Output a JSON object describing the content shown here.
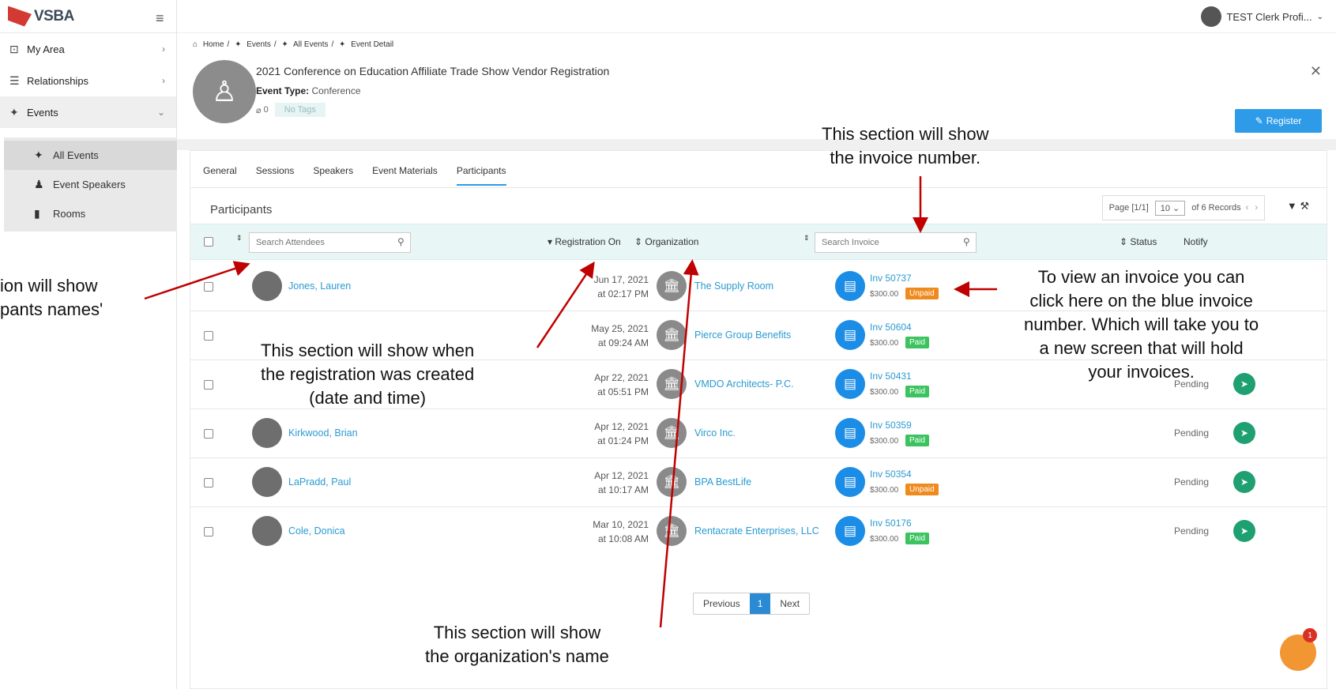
{
  "logo": {
    "text": "VSBA"
  },
  "user": {
    "name": "TEST Clerk Profi...",
    "chevron": "⌄"
  },
  "sidebar": {
    "items": [
      {
        "label": "My Area",
        "icon": "⊡"
      },
      {
        "label": "Relationships",
        "icon": "☰"
      },
      {
        "label": "Events",
        "icon": "✦"
      }
    ],
    "sub_items": [
      {
        "label": "All Events"
      },
      {
        "label": "Event Speakers"
      },
      {
        "label": "Rooms"
      }
    ]
  },
  "breadcrumb": [
    "Home",
    "Events",
    "All Events",
    "Event Detail"
  ],
  "event": {
    "title": "2021 Conference on Education Affiliate Trade Show Vendor Registration",
    "type_label": "Event Type:",
    "type_value": "Conference",
    "tag_count": "0",
    "no_tags": "No Tags",
    "register": "Register"
  },
  "tabs": [
    "General",
    "Sessions",
    "Speakers",
    "Event Materials",
    "Participants"
  ],
  "participants_title": "Participants",
  "pager": {
    "page": "Page [1/1]",
    "per_page": "10",
    "records": "of 6 Records"
  },
  "table": {
    "search_attendees_placeholder": "Search Attendees",
    "registration_on": "Registration On",
    "organization": "Organization",
    "search_invoice_placeholder": "Search Invoice",
    "status": "Status",
    "notify": "Notify"
  },
  "rows": [
    {
      "name": "Jones, Lauren",
      "date": "Jun 17, 2021",
      "time": "at 02:17 PM",
      "org": "The Supply Room",
      "inv": "Inv 50737",
      "amount": "$300.00",
      "paid": "Unpaid",
      "status": ""
    },
    {
      "name": "",
      "date": "May 25, 2021",
      "time": "at 09:24 AM",
      "org": "Pierce Group Benefits",
      "inv": "Inv 50604",
      "amount": "$300.00",
      "paid": "Paid",
      "status": ""
    },
    {
      "name": "",
      "date": "Apr 22, 2021",
      "time": "at 05:51 PM",
      "org": "VMDO Architects- P.C.",
      "inv": "Inv 50431",
      "amount": "$300.00",
      "paid": "Paid",
      "status": "Pending"
    },
    {
      "name": "Kirkwood, Brian",
      "date": "Apr 12, 2021",
      "time": "at 01:24 PM",
      "org": "Virco Inc.",
      "inv": "Inv 50359",
      "amount": "$300.00",
      "paid": "Paid",
      "status": "Pending"
    },
    {
      "name": "LaPradd, Paul",
      "date": "Apr 12, 2021",
      "time": "at 10:17 AM",
      "org": "BPA BestLife",
      "inv": "Inv 50354",
      "amount": "$300.00",
      "paid": "Unpaid",
      "status": "Pending"
    },
    {
      "name": "Cole, Donica",
      "date": "Mar 10, 2021",
      "time": "at 10:08 AM",
      "org": "Rentacrate Enterprises, LLC",
      "inv": "Inv 50176",
      "amount": "$300.00",
      "paid": "Paid",
      "status": "Pending"
    }
  ],
  "pagination": {
    "prev": "Previous",
    "current": "1",
    "next": "Next"
  },
  "chat_badge": "1",
  "annotations": {
    "invoice_number": [
      "This section will show",
      "the invoice number."
    ],
    "names": [
      "ion will show",
      "pants names'"
    ],
    "registration": [
      "This section will show when",
      "the registration was created",
      "(date and time)"
    ],
    "view_invoice": [
      "To view an invoice you can",
      "click here on the blue invoice",
      "number. Which will take you to",
      "a new screen that will hold",
      "your invoices."
    ],
    "organization": [
      "This section will show",
      "the organization's name"
    ]
  },
  "colors": {
    "accent": "#2d9be8",
    "paid": "#3cc35f",
    "unpaid": "#ef8a1f",
    "notify": "#1fa071",
    "arrow": "#c00000"
  }
}
